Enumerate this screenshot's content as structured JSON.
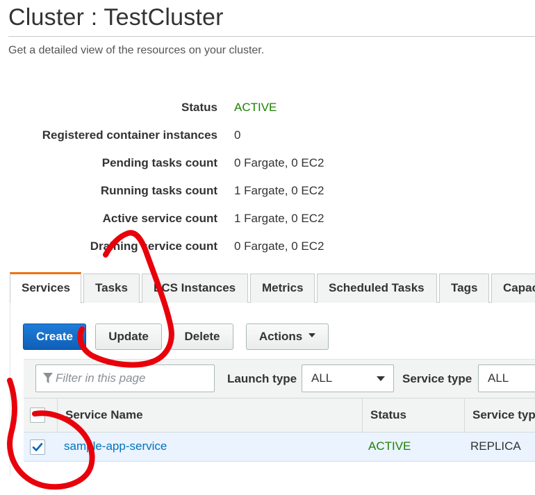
{
  "header": {
    "title": "Cluster : TestCluster",
    "subtitle": "Get a detailed view of the resources on your cluster."
  },
  "details": [
    {
      "label": "Status",
      "value": "ACTIVE",
      "status": "active"
    },
    {
      "label": "Registered container instances",
      "value": "0"
    },
    {
      "label": "Pending tasks count",
      "value": "0 Fargate, 0 EC2"
    },
    {
      "label": "Running tasks count",
      "value": "1 Fargate, 0 EC2"
    },
    {
      "label": "Active service count",
      "value": "1 Fargate, 0 EC2"
    },
    {
      "label": "Draining service count",
      "value": "0 Fargate, 0 EC2"
    }
  ],
  "tabs": [
    {
      "label": "Services",
      "selected": true
    },
    {
      "label": "Tasks"
    },
    {
      "label": "ECS Instances"
    },
    {
      "label": "Metrics"
    },
    {
      "label": "Scheduled Tasks"
    },
    {
      "label": "Tags"
    },
    {
      "label": "Capacity Providers"
    }
  ],
  "toolbar": {
    "create_label": "Create",
    "update_label": "Update",
    "delete_label": "Delete",
    "actions_label": "Actions"
  },
  "filters": {
    "search_placeholder": "Filter in this page",
    "launch_type_label": "Launch type",
    "launch_type_value": "ALL",
    "service_type_label": "Service type",
    "service_type_value": "ALL"
  },
  "table": {
    "columns": [
      "Service Name",
      "Status",
      "Service type"
    ],
    "rows": [
      {
        "service_name": "sample-app-service",
        "status": "ACTIVE",
        "service_type": "REPLICA",
        "selected": true
      }
    ]
  },
  "colors": {
    "active_status": "#1d8102",
    "link": "#0073bb",
    "primary_button": "#0f5fb8",
    "selected_tab_accent": "#ec7211",
    "annotation_marker": "#e8000b"
  }
}
